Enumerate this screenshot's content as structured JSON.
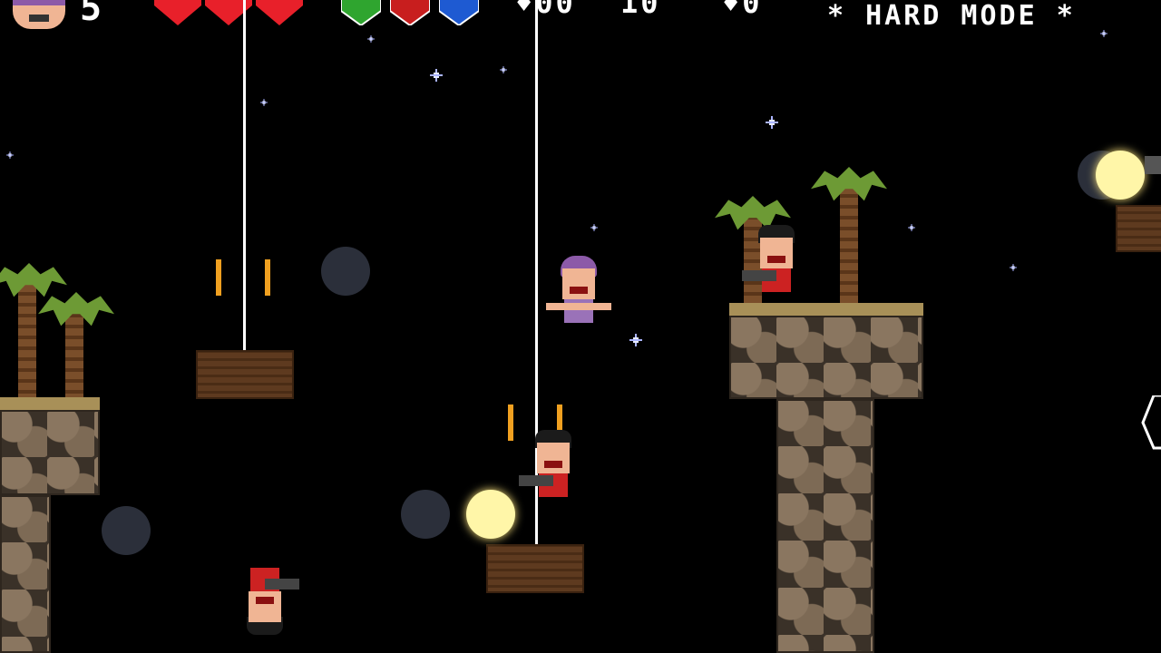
{
  "hud": {
    "player_icon": "player-face-icon",
    "lives": "5",
    "hearts": [
      "#e8202a",
      "#e8202a",
      "#e8202a"
    ],
    "gems": [
      {
        "name": "green-gem-icon",
        "color": "#2fa52f"
      },
      {
        "name": "red-gem-icon",
        "color": "#c81e1e"
      },
      {
        "name": "blue-gem-icon",
        "color": "#1e5ad2"
      }
    ],
    "stat_1": "♦00",
    "stat_2": "10",
    "stat_3": "♦0",
    "mode_label": "* HARD MODE *"
  },
  "colors": {
    "background": "#000000",
    "hearts": "#e8202a",
    "stars": "#aab4ff"
  }
}
